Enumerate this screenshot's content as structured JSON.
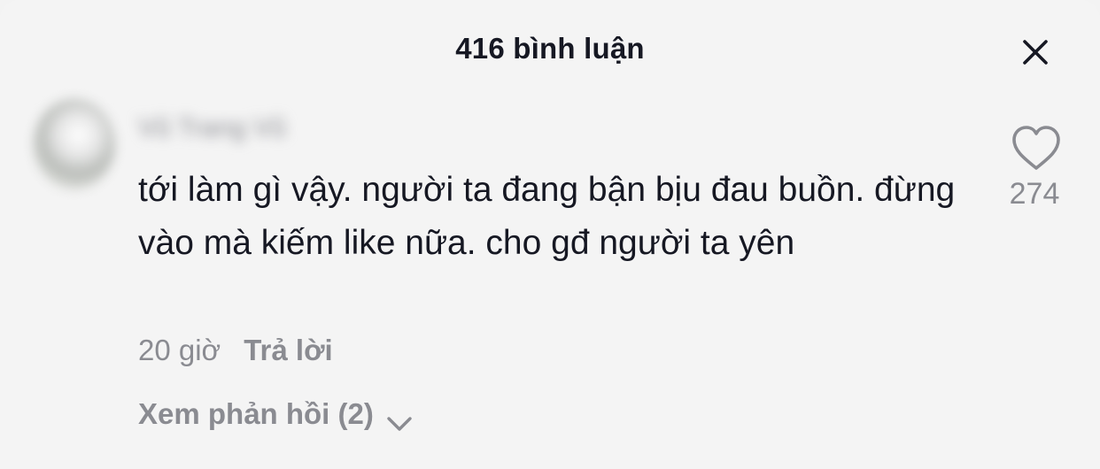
{
  "header": {
    "title": "416 bình luận",
    "close_icon": "close-icon"
  },
  "comment": {
    "avatar_icon": "avatar-blurred",
    "username": "Vũ Trang Vũ",
    "text": "tới làm gì vậy. người ta đang bận bịu đau buồn. đừng vào mà kiếm like nữa. cho gđ người ta yên",
    "time": "20 giờ",
    "reply_label": "Trả lời",
    "like_icon": "heart-outline-icon",
    "like_count": "274",
    "view_replies_label": "Xem phản hồi (2)",
    "view_replies_icon": "chevron-down-icon"
  },
  "colors": {
    "background": "#f4f4f4",
    "primary_text": "#161823",
    "secondary_text": "#8a8b91"
  }
}
